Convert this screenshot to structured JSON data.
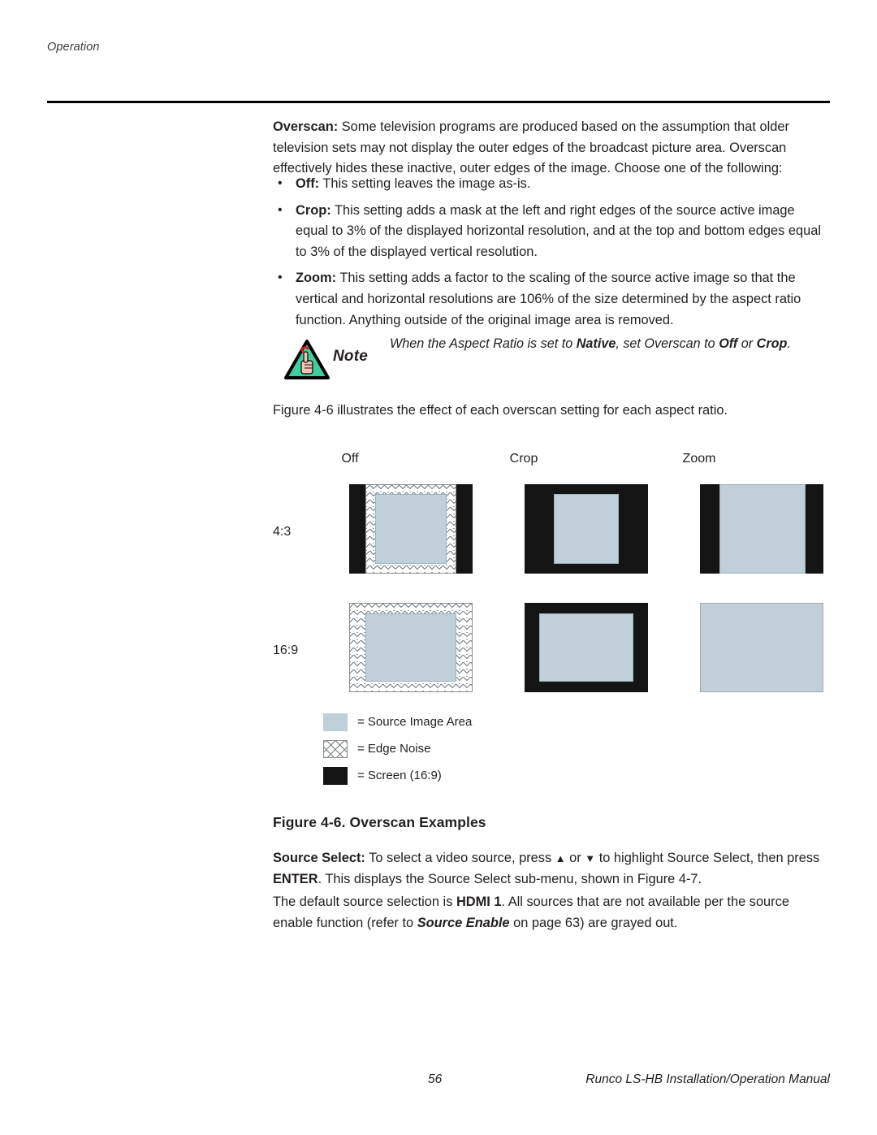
{
  "header": {
    "running_head": "Operation"
  },
  "body": {
    "overscan_label": "Overscan:",
    "overscan_text": " Some television programs are produced based on the assumption that older television sets may not display the outer edges of the broadcast picture area. Overscan effectively hides these inactive, outer edges of the image. Choose one of the following:",
    "bullets": [
      {
        "label": "Off:",
        "text": " This setting leaves the image as-is."
      },
      {
        "label": "Crop:",
        "text": " This setting adds a mask at the left and right edges of the source active image equal to 3% of the displayed horizontal resolution, and at the top and bottom edges equal to 3% of the displayed vertical resolution."
      },
      {
        "label": "Zoom:",
        "text": " This setting adds a factor to the scaling of the source active image so that the vertical and horizontal resolutions are 106% of the size determined by the aspect ratio function. Anything outside of the original image area is removed."
      }
    ],
    "figure_ref": "Figure 4-6 illustrates the effect of each overscan setting for each aspect ratio.",
    "source_select_label": "Source Select:",
    "source_select_1": " To select a video source, press ",
    "source_select_up": "▲",
    "source_select_or": " or ",
    "source_select_down": "▼",
    "source_select_2": " to highlight Source Select, then press ",
    "source_select_enter": "ENTER",
    "source_select_3": ". This displays the Source Select sub-menu, shown in Figure 4-7.",
    "default_1": "The default source selection is ",
    "default_hdmi": "HDMI 1",
    "default_2": ". All sources that are not available per the source enable function (refer to ",
    "default_source_enable": "Source Enable",
    "default_3": " on page 63) are grayed out."
  },
  "note": {
    "icon": "note-hand-triangle-icon",
    "label": "Note",
    "text_1": "When the Aspect Ratio is set to ",
    "text_native": "Native",
    "text_2": ", set Overscan to ",
    "text_off": "Off",
    "text_3": " or ",
    "text_crop": "Crop",
    "text_4": "."
  },
  "figure": {
    "caption": "Figure 4-6. Overscan Examples",
    "column_headers": [
      "Off",
      "Crop",
      "Zoom"
    ],
    "row_headers": [
      "4:3",
      "16:9"
    ],
    "legend": [
      {
        "swatch": "source-image-area",
        "label": "= Source Image Area"
      },
      {
        "swatch": "edge-noise",
        "label": "= Edge Noise"
      },
      {
        "swatch": "screen-16-9",
        "label": "= Screen (16:9)"
      }
    ],
    "colors": {
      "source_image_area": "#c0cfd8",
      "screen": "#141414",
      "edge_noise_line": "#707c85"
    }
  },
  "footer": {
    "page_number": "56",
    "manual_title": "Runco LS-HB Installation/Operation Manual"
  }
}
